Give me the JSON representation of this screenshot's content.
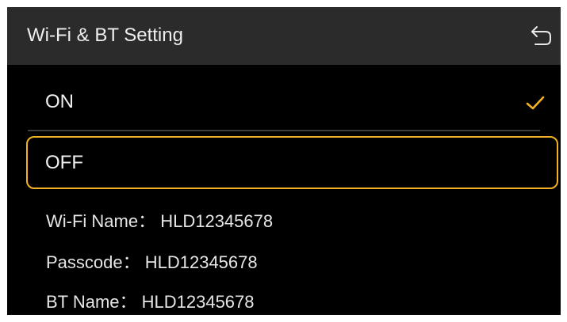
{
  "header": {
    "title": "Wi-Fi & BT Setting",
    "back_icon": "back-arrow-icon"
  },
  "options": [
    {
      "label": "ON",
      "selected": true,
      "check_icon": "check-icon"
    },
    {
      "label": "OFF",
      "focused": true
    }
  ],
  "info": {
    "wifi_name": "Wi-Fi Name： HLD12345678",
    "passcode": "Passcode： HLD12345678",
    "bt_name": "BT Name： HLD12345678"
  },
  "colors": {
    "accent": "#f2b224",
    "header_bg": "#2b2b2b",
    "background": "#000000",
    "text": "#eeeeee"
  }
}
